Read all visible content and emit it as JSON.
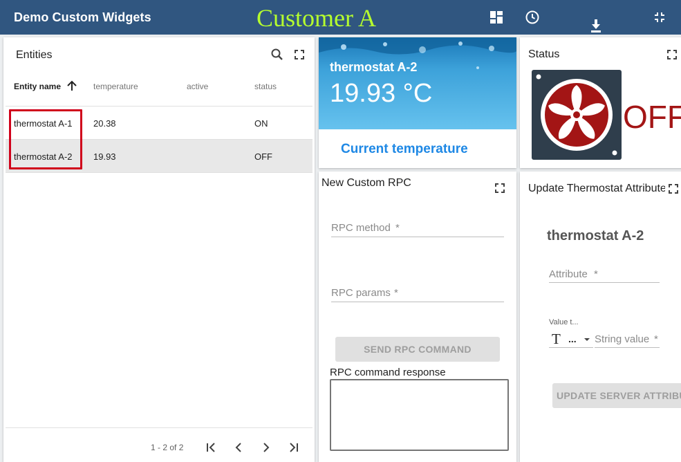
{
  "header": {
    "app_title": "Demo Custom Widgets",
    "customer_title": "Customer A"
  },
  "entities": {
    "title": "Entities",
    "columns": [
      "Entity name",
      "temperature",
      "active",
      "status"
    ],
    "rows": [
      {
        "name": "thermostat A-1",
        "temperature": "20.38",
        "active": "",
        "status": "ON"
      },
      {
        "name": "thermostat A-2",
        "temperature": "19.93",
        "active": "",
        "status": "OFF"
      }
    ],
    "pagination": "1 - 2 of 2"
  },
  "temperature_card": {
    "entity": "thermostat A-2",
    "value": "19.93 °C",
    "caption": "Current temperature"
  },
  "status_card": {
    "title": "Status",
    "state": "OFF"
  },
  "rpc_card": {
    "title": "New Custom RPC",
    "method_label": "RPC method",
    "params_label": "RPC params",
    "required_mark": "*",
    "send_button": "SEND RPC COMMAND",
    "response_label": "RPC command response"
  },
  "attributes_card": {
    "title": "Update Thermostat Attributes",
    "entity": "thermostat A-2",
    "attribute_label": "Attribute",
    "value_type_label": "Value t...",
    "value_type_short": "...",
    "string_value_label": "String value",
    "required_mark": "*",
    "update_button": "UPDATE SERVER ATTRIBUTE"
  },
  "colors": {
    "topbar": "#305680",
    "customer_title": "#b6ff2e",
    "status_off": "#a31515",
    "highlight_box": "#d0021b",
    "accent_blue": "#1e88e5"
  }
}
